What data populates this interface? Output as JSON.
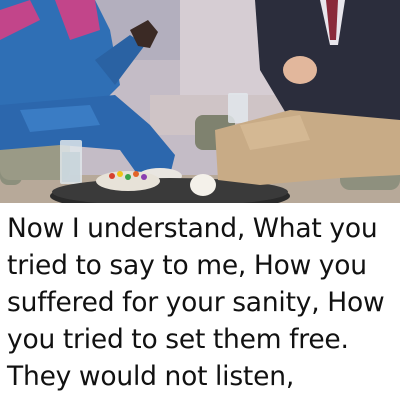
{
  "caption": {
    "text": "Now I understand, What you tried to say to me, How you suffered for your sanity, How you tried to set them free. They would not listen,"
  },
  "photo": {
    "description_icon": "tv-interview-photo"
  },
  "colors": {
    "background": "#ffffff",
    "text": "#111111",
    "tracksuit_blue": "#2f6fb5",
    "tracksuit_pink": "#c2458a",
    "suit_dark": "#2b2d3c",
    "trousers_khaki": "#c8ab86"
  }
}
